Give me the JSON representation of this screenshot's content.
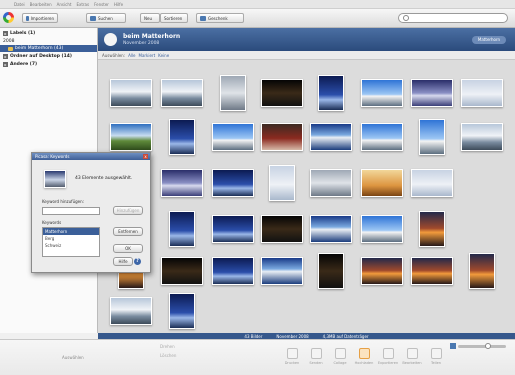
{
  "menubar": {
    "items": [
      "Datei",
      "Bearbeiten",
      "Ansicht",
      "Extras",
      "Fenster",
      "Hilfe"
    ]
  },
  "toolbar": {
    "import": "Importieren",
    "search": "Suchen",
    "new_label": "Neu",
    "sort": "Sortieren",
    "share": "Geschenk"
  },
  "sidebar": {
    "labels": "Labels (1)",
    "year": "2008",
    "album": "beim Matterhorn (43)",
    "desktop": "Ordner auf Desktop (14)",
    "other": "Andere (7)"
  },
  "album_header": {
    "title": "beim Matterhorn",
    "date": "November 2008",
    "sort_pill": "Matterhorn"
  },
  "filter": {
    "label": "Auswählen:",
    "link1": "Alle",
    "link2": "Markiert",
    "link3": "Keine"
  },
  "thumbnails": [
    {
      "style": "t-cloud"
    },
    {
      "style": "t-cloud"
    },
    {
      "style": "t-grey"
    },
    {
      "style": "t-dark"
    },
    {
      "style": "t-night"
    },
    {
      "style": "t-day"
    },
    {
      "style": "t-violet"
    },
    {
      "style": "t-pale"
    },
    {
      "style": "t-green"
    },
    {
      "style": "t-night"
    },
    {
      "style": "t-day"
    },
    {
      "style": "t-red"
    },
    {
      "style": "t-lake"
    },
    {
      "style": "t-day"
    },
    {
      "style": "t-day"
    },
    {
      "style": "t-cloud"
    },
    {
      "style": "t-night"
    },
    {
      "style": "t-violet"
    },
    {
      "style": "t-night"
    },
    {
      "style": "t-pale"
    },
    {
      "style": "t-grey"
    },
    {
      "style": "t-gold"
    },
    {
      "style": "t-pale"
    },
    {
      "style": "t-violet"
    },
    {
      "style": "t-night"
    },
    {
      "style": "t-night"
    },
    {
      "style": "t-dark"
    },
    {
      "style": "t-lake"
    },
    {
      "style": "t-day"
    },
    {
      "style": "t-sunset"
    },
    {
      "style": "t-sunset"
    },
    {
      "style": "t-dark"
    },
    {
      "style": "t-night"
    },
    {
      "style": "t-lake"
    },
    {
      "style": "t-dark"
    },
    {
      "style": "t-sunset"
    },
    {
      "style": "t-sunset"
    },
    {
      "style": "t-sunset"
    },
    {
      "style": "t-cloud"
    },
    {
      "style": "t-night"
    }
  ],
  "status": {
    "count": "43 Bilder",
    "date": "November 2008",
    "size": "4,3MB auf Datenträger"
  },
  "bottom": {
    "left_label": "Auswählen",
    "mid1": "Drehen",
    "mid2": "Löschen",
    "tools": [
      "Drucken",
      "Senden",
      "Collage",
      "Hochladen",
      "Exportieren",
      "Bearbeiten",
      "Teilen"
    ]
  },
  "dialog": {
    "title": "Picasa: Keywords",
    "message": "43 Elemente ausgewählt.",
    "add_label": "Keyword hinzufügen:",
    "add_button": "Hinzufügen",
    "keywords_label": "Keywords",
    "keywords": [
      "Matterhorn",
      "Berg",
      "Schweiz"
    ],
    "remove_button": "Entfernen",
    "ok_button": "OK",
    "help_button": "Hilfe",
    "help_icon": "?",
    "close": "x"
  }
}
